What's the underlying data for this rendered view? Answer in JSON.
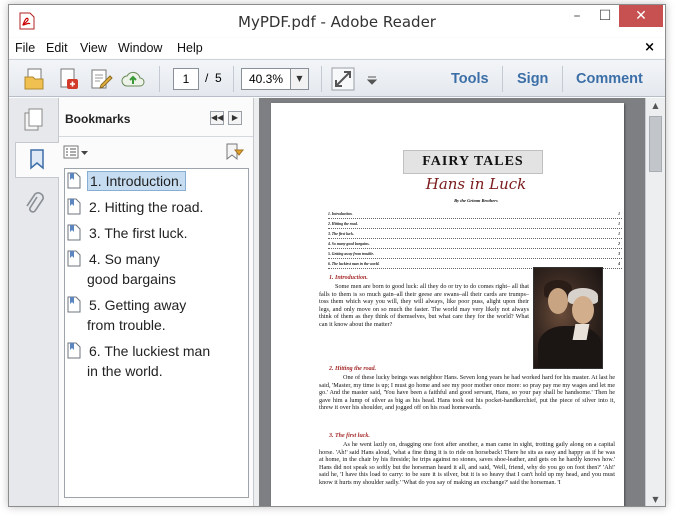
{
  "window": {
    "title": "MyPDF.pdf - Adobe Reader",
    "controls": {
      "minimize": "–",
      "maximize": "☐",
      "close": "✕"
    }
  },
  "menu": {
    "items": [
      "File",
      "Edit",
      "View",
      "Window",
      "Help"
    ],
    "close_doc": "×"
  },
  "toolbar": {
    "current_page": "1",
    "page_separator": "/",
    "total_pages": "5",
    "zoom": "40.3%",
    "links": [
      "Tools",
      "Sign",
      "Comment"
    ]
  },
  "bookmarks": {
    "title": "Bookmarks",
    "items": [
      {
        "lines": [
          "1. Introduction."
        ],
        "selected": true
      },
      {
        "lines": [
          "2. Hitting the road."
        ],
        "selected": false
      },
      {
        "lines": [
          "3. The first luck."
        ],
        "selected": false
      },
      {
        "lines": [
          "4. So many good",
          "bargains"
        ],
        "selected": false
      },
      {
        "lines": [
          "5. Getting away from",
          "trouble."
        ],
        "selected": false
      },
      {
        "lines": [
          "6. The luckiest man in",
          "the world."
        ],
        "selected": false
      }
    ]
  },
  "document": {
    "title": "FAIRY TALES",
    "subtitle": "Hans in Luck",
    "byline": "By the Grimm Brothers",
    "toc": [
      {
        "label": "1. Introduction.",
        "page": "1"
      },
      {
        "label": "2. Hitting the road.",
        "page": "1"
      },
      {
        "label": "3. The first luck.",
        "page": "1"
      },
      {
        "label": "4. So many good bargains.",
        "page": "2"
      },
      {
        "label": "5. Getting away from trouble.",
        "page": "3"
      },
      {
        "label": "6. The luckiest man in the world.",
        "page": "4"
      }
    ],
    "sections": [
      {
        "heading": "1. Introduction.",
        "text": "Some men are born to good luck: all they do or try to do comes right– all that falls to them is so much gain–all their geese are swans–all their cards are trumps–toss them which way you will, they will always, like poor puss, alight upon their legs, and only move on so much the faster. The world may very likely not always think of them as they think of themselves, but what care they for the world? What can it know about the matter?"
      },
      {
        "heading": "2. Hitting the road.",
        "text": "One of these lucky beings was neighbor Hans. Seven long years he had worked hard for his master. At last he said, 'Master, my time is up; I must go home and see my poor mother once more: so pray pay me my wages and let me go.' And the master said, 'You have been a faithful and good servant, Hans, so your pay shall be handsome.' Then he gave him a lump of silver as big as his head. Hans took out his pocket-handkerchief, put the piece of silver into it, threw it over his shoulder, and jogged off on his road homewards."
      },
      {
        "heading": "3. The first luck.",
        "text": "As he went lazily on, dragging one foot after another, a man came in sight, trotting gaily along on a capital horse. 'Ah!' said Hans aloud, 'what a fine thing it is to ride on horseback! There he sits as easy and happy as if he was at home, in the chair by his fireside; he trips against no stones, saves shoe-leather, and gets on he hardly knows how.' Hans did not speak so softly but the horseman heard it all, and said, 'Well, friend, why do you go on foot then?' 'Ah!' said he, 'I have this load to carry: to be sure it is silver, but it is so heavy that I can't hold up my head, and you must know it hurts my shoulder sadly.' 'What do you say of making an exchange?' said the horseman. 'I"
      }
    ]
  }
}
